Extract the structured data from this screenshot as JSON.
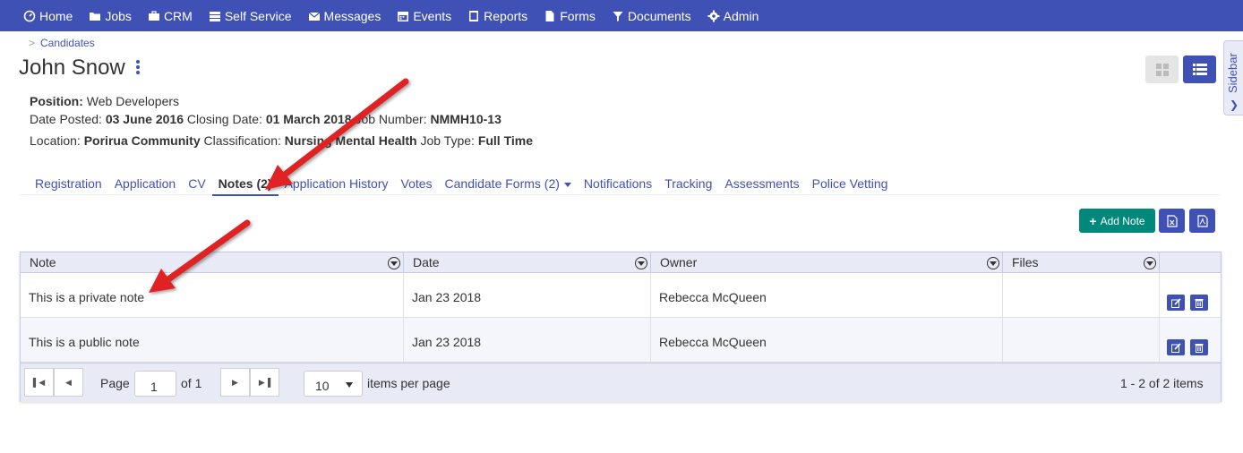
{
  "nav": {
    "items": [
      {
        "label": "Home",
        "icon": "dashboard-icon"
      },
      {
        "label": "Jobs",
        "icon": "folder-icon"
      },
      {
        "label": "CRM",
        "icon": "briefcase-icon"
      },
      {
        "label": "Self Service",
        "icon": "server-icon"
      },
      {
        "label": "Messages",
        "icon": "envelope-icon"
      },
      {
        "label": "Events",
        "icon": "calendar-icon"
      },
      {
        "label": "Reports",
        "icon": "report-icon"
      },
      {
        "label": "Forms",
        "icon": "file-icon"
      },
      {
        "label": "Documents",
        "icon": "filter-icon"
      },
      {
        "label": "Admin",
        "icon": "gear-icon"
      }
    ],
    "color": "#3f51b5"
  },
  "breadcrumb": {
    "separator": ">",
    "link": "Candidates"
  },
  "title": "John Snow",
  "sidebar_label": "Sidebar",
  "info": {
    "position_label": "Position:",
    "position_value": "Web Developers",
    "date_posted_label": "Date Posted:",
    "date_posted_value": "03 June 2016",
    "closing_label": "Closing Date:",
    "closing_value": "01 March 2018",
    "job_number_label": "Job Number:",
    "job_number_value": "NMMH10-13",
    "location_label": "Location:",
    "location_value": "Porirua Community",
    "classification_label": "Classification:",
    "classification_value": "Nursing Mental Health",
    "job_type_label": "Job Type:",
    "job_type_value": "Full Time"
  },
  "tabs": [
    {
      "label": "Registration"
    },
    {
      "label": "Application"
    },
    {
      "label": "CV"
    },
    {
      "label": "Notes (2)",
      "active": true
    },
    {
      "label": "Application History"
    },
    {
      "label": "Votes"
    },
    {
      "label": "Candidate Forms (2)",
      "dropdown": true
    },
    {
      "label": "Notifications"
    },
    {
      "label": "Tracking"
    },
    {
      "label": "Assessments"
    },
    {
      "label": "Police Vetting"
    }
  ],
  "toolbar": {
    "add_label": "Add Note",
    "add_color": "#00897b"
  },
  "grid": {
    "columns": [
      "Note",
      "Date",
      "Owner",
      "Files"
    ],
    "rows": [
      {
        "note": "This is a private note",
        "date": "Jan 23 2018",
        "owner": "Rebecca McQueen",
        "files": ""
      },
      {
        "note": "This is a public note",
        "date": "Jan 23 2018",
        "owner": "Rebecca McQueen",
        "files": ""
      }
    ]
  },
  "pager": {
    "page_label": "Page",
    "page_value": "1",
    "of_label": "of 1",
    "per_page_value": "10",
    "per_page_label": "items per page",
    "summary": "1 - 2 of 2 items"
  },
  "annotation_color": "#e02020"
}
